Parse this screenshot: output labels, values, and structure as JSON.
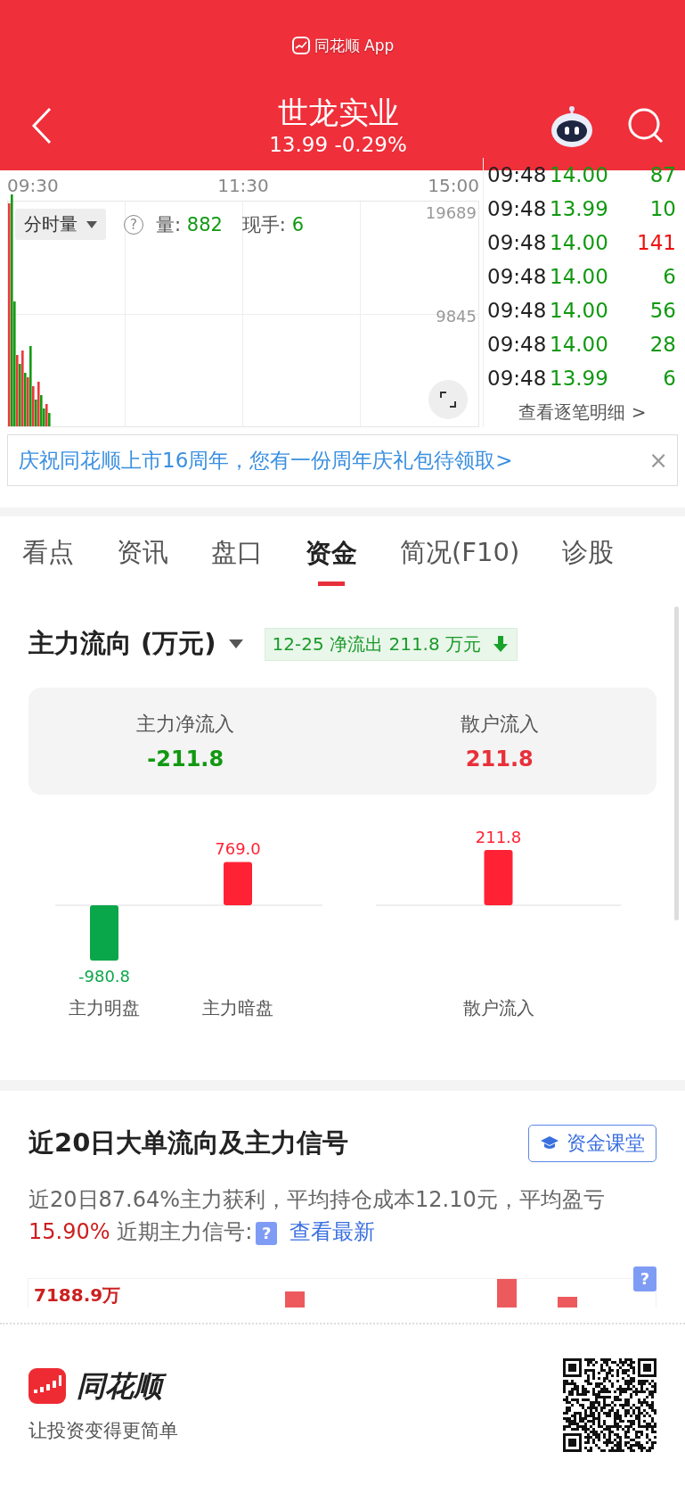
{
  "app_banner": {
    "label": "同花顺 App"
  },
  "header": {
    "title": "世龙实业",
    "quote": "13.99 -0.29%"
  },
  "intraday": {
    "times": [
      "09:30",
      "11:30",
      "15:00"
    ],
    "y_labels": [
      "19689",
      "9845"
    ],
    "mode": "分时量",
    "volume_label": "量:",
    "volume_value": "882",
    "hand_label": "现手:",
    "hand_value": "6",
    "help": "?"
  },
  "trades": [
    {
      "time": "09:48",
      "price": "14.00",
      "volume": "87",
      "color": "#119911"
    },
    {
      "time": "09:48",
      "price": "13.99",
      "volume": "10",
      "color": "#119911"
    },
    {
      "time": "09:48",
      "price": "14.00",
      "volume": "141",
      "color": "#ee1111"
    },
    {
      "time": "09:48",
      "price": "14.00",
      "volume": "6",
      "color": "#119911"
    },
    {
      "time": "09:48",
      "price": "14.00",
      "volume": "56",
      "color": "#119911"
    },
    {
      "time": "09:48",
      "price": "14.00",
      "volume": "28",
      "color": "#119911"
    },
    {
      "time": "09:48",
      "price": "13.99",
      "volume": "6",
      "color": "#119911"
    }
  ],
  "trades_link": "查看逐笔明细 >",
  "promo": {
    "text": "庆祝同花顺上市16周年，您有一份周年庆礼包待领取>",
    "close": "×"
  },
  "tabs": [
    {
      "label": "看点",
      "selected": false
    },
    {
      "label": "资讯",
      "selected": false
    },
    {
      "label": "盘口",
      "selected": false
    },
    {
      "label": "资金",
      "selected": true
    },
    {
      "label": "简况(F10)",
      "selected": false
    },
    {
      "label": "诊股",
      "selected": false
    }
  ],
  "flow": {
    "title": "主力流向 (万元)",
    "badge": "12-25 净流出 211.8 万元",
    "summary": [
      {
        "label": "主力净流入",
        "value": "-211.8",
        "color": "#119911"
      },
      {
        "label": "散户流入",
        "value": "211.8",
        "color": "#e8303a"
      }
    ],
    "charts": [
      {
        "chart_data": {
          "type": "bar",
          "categories": [
            "主力明盘",
            "主力暗盘"
          ],
          "values": [
            -980.8,
            769.0
          ],
          "value_labels": [
            "-980.8",
            "769.0"
          ]
        }
      },
      {
        "chart_data": {
          "type": "bar",
          "categories": [
            "散户流入"
          ],
          "values": [
            211.8
          ],
          "value_labels": [
            "211.8"
          ]
        }
      }
    ]
  },
  "signals": {
    "title": "近20日大单流向及主力信号",
    "button": "资金课堂",
    "text_parts": [
      {
        "text": "近20日87.64%主力获利，平均持仓成本12.10元，平均盈亏 ",
        "kind": "plain"
      },
      {
        "text": "15.90%",
        "kind": "loss"
      },
      {
        "text": " 近期主力信号:",
        "kind": "plain"
      }
    ],
    "help": "?",
    "link": "查看最新",
    "chart_help": "?",
    "chart_label": "7188.9万"
  },
  "footer": {
    "brand": "同花顺",
    "slogan": "让投资变得更简单"
  }
}
